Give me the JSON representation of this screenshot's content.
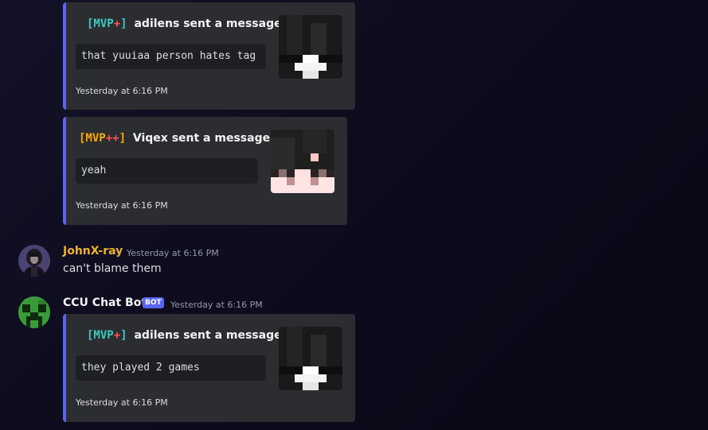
{
  "embeds": [
    {
      "rank_open": "[MVP",
      "rank_plus": "+",
      "rank_close": "]",
      "rank_color": "#3dc9c0",
      "author": "adilens sent a message.",
      "message": "that yuuiaa person hates tag",
      "footer": "Yesterday at 6:16 PM",
      "thumbnail_icon": "player-head-dark-hair"
    },
    {
      "rank_open": "[MVP",
      "rank_plus": "++",
      "rank_close": "]",
      "rank_color": "#ffaa00",
      "author": "Viqex sent a message.",
      "message": "yeah",
      "footer": "Yesterday at 6:16 PM",
      "thumbnail_icon": "player-head-pale-skin"
    },
    {
      "rank_open": "[MVP",
      "rank_plus": "+",
      "rank_close": "]",
      "rank_color": "#3dc9c0",
      "author": "adilens sent a message.",
      "message": "they played 2 games",
      "footer": "Yesterday at 6:16 PM",
      "thumbnail_icon": "player-head-dark-hair"
    }
  ],
  "messages": [
    {
      "username": "JohnX-ray",
      "username_color": "#f0b132",
      "timestamp": "Yesterday at 6:16 PM",
      "text": "can't blame them",
      "avatar_icon": "user-avatar-dark"
    },
    {
      "username": "CCU Chat Bot",
      "username_color": "#f2f3f5",
      "bot_tag": "BOT",
      "timestamp": "Yesterday at 6:16 PM",
      "avatar_icon": "creeper-avatar"
    }
  ],
  "colors": {
    "embed_bg": "#2b2d31",
    "embed_border": "#5865f2",
    "code_bg": "#1e1f22",
    "timestamp": "#949ba4"
  }
}
